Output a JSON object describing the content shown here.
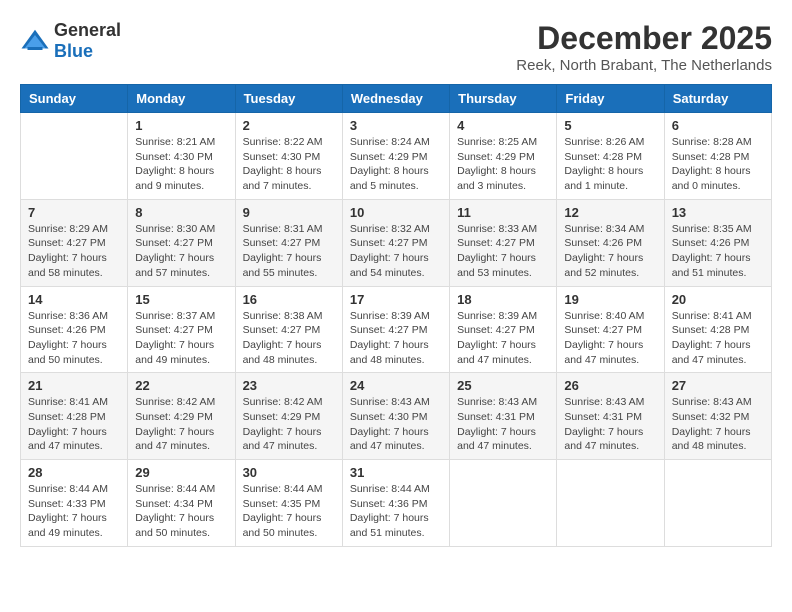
{
  "header": {
    "logo_general": "General",
    "logo_blue": "Blue",
    "month": "December 2025",
    "location": "Reek, North Brabant, The Netherlands"
  },
  "days_of_week": [
    "Sunday",
    "Monday",
    "Tuesday",
    "Wednesday",
    "Thursday",
    "Friday",
    "Saturday"
  ],
  "weeks": [
    [
      {
        "day": "",
        "info": ""
      },
      {
        "day": "1",
        "info": "Sunrise: 8:21 AM\nSunset: 4:30 PM\nDaylight: 8 hours\nand 9 minutes."
      },
      {
        "day": "2",
        "info": "Sunrise: 8:22 AM\nSunset: 4:30 PM\nDaylight: 8 hours\nand 7 minutes."
      },
      {
        "day": "3",
        "info": "Sunrise: 8:24 AM\nSunset: 4:29 PM\nDaylight: 8 hours\nand 5 minutes."
      },
      {
        "day": "4",
        "info": "Sunrise: 8:25 AM\nSunset: 4:29 PM\nDaylight: 8 hours\nand 3 minutes."
      },
      {
        "day": "5",
        "info": "Sunrise: 8:26 AM\nSunset: 4:28 PM\nDaylight: 8 hours\nand 1 minute."
      },
      {
        "day": "6",
        "info": "Sunrise: 8:28 AM\nSunset: 4:28 PM\nDaylight: 8 hours\nand 0 minutes."
      }
    ],
    [
      {
        "day": "7",
        "info": "Sunrise: 8:29 AM\nSunset: 4:27 PM\nDaylight: 7 hours\nand 58 minutes."
      },
      {
        "day": "8",
        "info": "Sunrise: 8:30 AM\nSunset: 4:27 PM\nDaylight: 7 hours\nand 57 minutes."
      },
      {
        "day": "9",
        "info": "Sunrise: 8:31 AM\nSunset: 4:27 PM\nDaylight: 7 hours\nand 55 minutes."
      },
      {
        "day": "10",
        "info": "Sunrise: 8:32 AM\nSunset: 4:27 PM\nDaylight: 7 hours\nand 54 minutes."
      },
      {
        "day": "11",
        "info": "Sunrise: 8:33 AM\nSunset: 4:27 PM\nDaylight: 7 hours\nand 53 minutes."
      },
      {
        "day": "12",
        "info": "Sunrise: 8:34 AM\nSunset: 4:26 PM\nDaylight: 7 hours\nand 52 minutes."
      },
      {
        "day": "13",
        "info": "Sunrise: 8:35 AM\nSunset: 4:26 PM\nDaylight: 7 hours\nand 51 minutes."
      }
    ],
    [
      {
        "day": "14",
        "info": "Sunrise: 8:36 AM\nSunset: 4:26 PM\nDaylight: 7 hours\nand 50 minutes."
      },
      {
        "day": "15",
        "info": "Sunrise: 8:37 AM\nSunset: 4:27 PM\nDaylight: 7 hours\nand 49 minutes."
      },
      {
        "day": "16",
        "info": "Sunrise: 8:38 AM\nSunset: 4:27 PM\nDaylight: 7 hours\nand 48 minutes."
      },
      {
        "day": "17",
        "info": "Sunrise: 8:39 AM\nSunset: 4:27 PM\nDaylight: 7 hours\nand 48 minutes."
      },
      {
        "day": "18",
        "info": "Sunrise: 8:39 AM\nSunset: 4:27 PM\nDaylight: 7 hours\nand 47 minutes."
      },
      {
        "day": "19",
        "info": "Sunrise: 8:40 AM\nSunset: 4:27 PM\nDaylight: 7 hours\nand 47 minutes."
      },
      {
        "day": "20",
        "info": "Sunrise: 8:41 AM\nSunset: 4:28 PM\nDaylight: 7 hours\nand 47 minutes."
      }
    ],
    [
      {
        "day": "21",
        "info": "Sunrise: 8:41 AM\nSunset: 4:28 PM\nDaylight: 7 hours\nand 47 minutes."
      },
      {
        "day": "22",
        "info": "Sunrise: 8:42 AM\nSunset: 4:29 PM\nDaylight: 7 hours\nand 47 minutes."
      },
      {
        "day": "23",
        "info": "Sunrise: 8:42 AM\nSunset: 4:29 PM\nDaylight: 7 hours\nand 47 minutes."
      },
      {
        "day": "24",
        "info": "Sunrise: 8:43 AM\nSunset: 4:30 PM\nDaylight: 7 hours\nand 47 minutes."
      },
      {
        "day": "25",
        "info": "Sunrise: 8:43 AM\nSunset: 4:31 PM\nDaylight: 7 hours\nand 47 minutes."
      },
      {
        "day": "26",
        "info": "Sunrise: 8:43 AM\nSunset: 4:31 PM\nDaylight: 7 hours\nand 47 minutes."
      },
      {
        "day": "27",
        "info": "Sunrise: 8:43 AM\nSunset: 4:32 PM\nDaylight: 7 hours\nand 48 minutes."
      }
    ],
    [
      {
        "day": "28",
        "info": "Sunrise: 8:44 AM\nSunset: 4:33 PM\nDaylight: 7 hours\nand 49 minutes."
      },
      {
        "day": "29",
        "info": "Sunrise: 8:44 AM\nSunset: 4:34 PM\nDaylight: 7 hours\nand 50 minutes."
      },
      {
        "day": "30",
        "info": "Sunrise: 8:44 AM\nSunset: 4:35 PM\nDaylight: 7 hours\nand 50 minutes."
      },
      {
        "day": "31",
        "info": "Sunrise: 8:44 AM\nSunset: 4:36 PM\nDaylight: 7 hours\nand 51 minutes."
      },
      {
        "day": "",
        "info": ""
      },
      {
        "day": "",
        "info": ""
      },
      {
        "day": "",
        "info": ""
      }
    ]
  ]
}
